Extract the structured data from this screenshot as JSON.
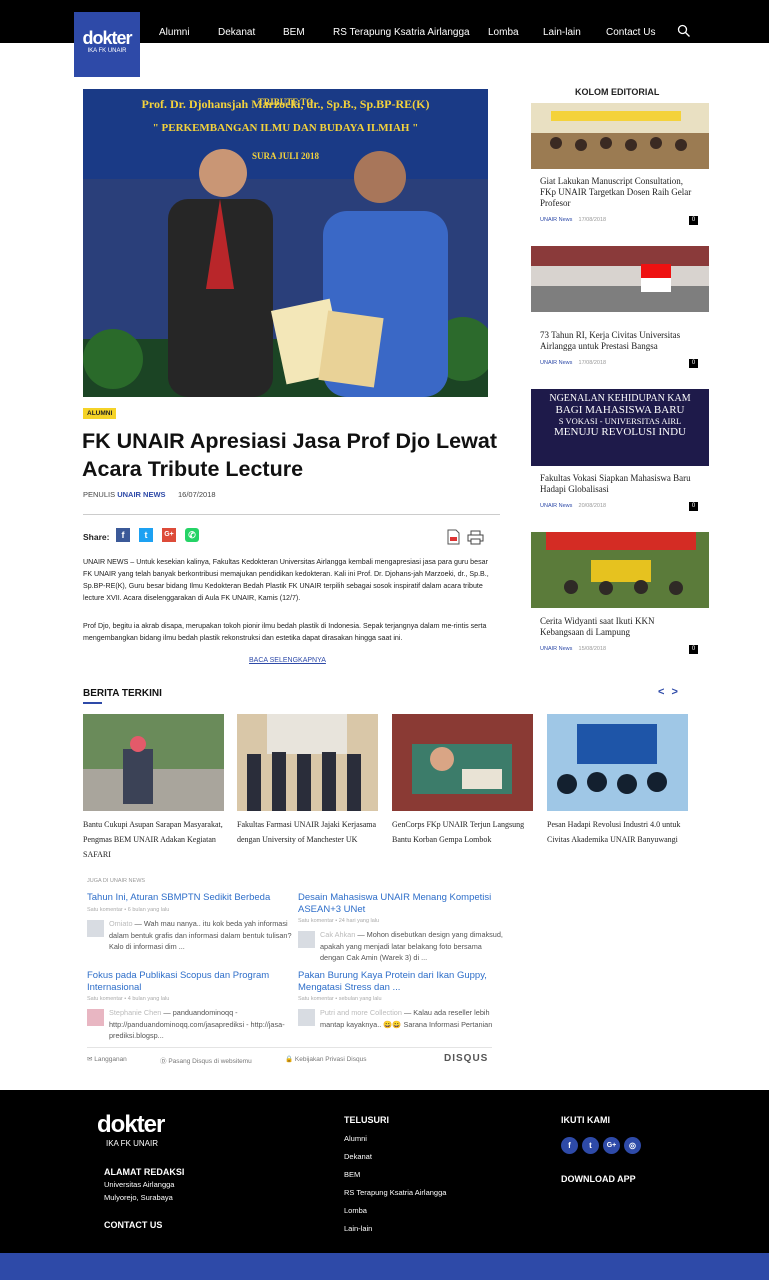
{
  "header": {
    "logo_word": "dokter",
    "logo_sub": "IKA FK UNAIR",
    "nav": [
      "Alumni",
      "Dekanat",
      "BEM",
      "RS Terapung Ksatria Airlangga",
      "Lomba",
      "Lain-lain",
      "Contact Us"
    ]
  },
  "article": {
    "hero_banner_line1": "TRIBUTE TO",
    "hero_banner_line2": "Prof. Dr. Djohansjah Marzoeki, dr., Sp.B., Sp.BP-RE(K)",
    "hero_banner_line3": "\" PERKEMBANGAN ILMU DAN BUDAYA ILMIAH \"",
    "hero_banner_line4": "SURA          JULI 2018",
    "category": "ALUMNI",
    "title": "FK UNAIR Apresiasi Jasa Prof Djo Lewat Acara Tribute Lecture",
    "author_label": "PENULIS",
    "author": "UNAIR NEWS",
    "date": "16/07/2018",
    "share_label": "Share:",
    "paragraph1": "UNAIR NEWS – Untuk kesekian kalinya, Fakultas Kedokteran Universitas Airlangga kembali mengapresiasi  jasa para guru besar FK UNAIR yang telah banyak berkontribusi memajukan pendidikan kedokteran. Kali ini Prof. Dr. Djohans-jah Marzoeki, dr., Sp.B., Sp.BP-RE(K), Guru besar bidang Ilmu Kedokteran Bedah Plastik FK UNAIR  terpilih sebagai sosok inspiratif dalam acara tribute lecture XVII. Acara diselenggarakan di Aula FK UNAIR, Kamis (12/7).",
    "paragraph2": "Prof Djo, begitu ia akrab disapa, merupakan tokoh pionir ilmu bedah plastik di Indonesia. Sepak terjangnya dalam me-rintis serta mengembangkan bidang ilmu bedah plastik rekonstruksi dan estetika dapat dirasakan hingga saat ini.",
    "read_more": "BACA SELENGKAPNYA"
  },
  "sidebar": {
    "heading": "KOLOM EDITORIAL",
    "items": [
      {
        "title": "Giat Lakukan Manuscript Consultation, FKp UNAIR Targetkan Dosen Raih Gelar Profesor",
        "source": "UNAIR News",
        "date": "17/08/2018",
        "count": "0"
      },
      {
        "title": "73 Tahun RI, Kerja Civitas Universitas Airlangga untuk Prestasi Bangsa",
        "source": "UNAIR News",
        "date": "17/08/2018",
        "count": "0"
      },
      {
        "title": "Fakultas Vokasi Siapkan Mahasiswa Baru Hadapi Globalisasi",
        "source": "UNAIR News",
        "date": "20/08/2018",
        "count": "0"
      },
      {
        "title": "Cerita Widyanti saat Ikuti KKN Kebangsaan di Lampung",
        "source": "UNAIR News",
        "date": "15/08/2018",
        "count": "0"
      }
    ],
    "banner_line1": "NGENALAN KEHIDUPAN KAM",
    "banner_line2": "BAGI MAHASISWA BARU",
    "banner_line3": "S VOKASI - UNIVERSITAS AIRL",
    "banner_line4": "MENUJU REVOLUSI INDU"
  },
  "berita_terkini": {
    "heading": "BERITA TERKINI",
    "arrows": "< >",
    "items": [
      "Bantu Cukupi Asupan Sarapan Masyarakat, Pengmas BEM UNAIR Adakan Kegiatan SAFARI",
      "Fakultas Farmasi UNAIR Jajaki Kerjasama dengan University of Manchester UK",
      "GenCorps FKp UNAIR Terjun Langsung Bantu Korban Gempa Lombok",
      "Pesan Hadapi Revolusi Industri 4.0 untuk Civitas Akademika UNAIR Banyuwangi"
    ]
  },
  "disqus": {
    "also_on": "JUGA DI UNAIR NEWS",
    "items": [
      {
        "title": "Tahun Ini, Aturan SBMPTN Sedikit Berbeda",
        "meta": "Satu komentar • 6 bulan yang lalu",
        "user": "Omiato",
        "comment": "Wah mau nanya.. itu kok beda yah informasi dalam bentuk grafis dan informasi dalam bentuk tulisan? Kalo di informasi dim ..."
      },
      {
        "title": "Desain Mahasiswa UNAIR Menang Kompetisi ASEAN+3 UNet",
        "meta": "Satu komentar • 24 hari yang lalu",
        "user": "Cak Ahkan",
        "comment": "Mohon disebutkan design yang dimaksud, apakah yang menjadi latar belakang foto bersama dengan Cak Amin (Warek 3) di ..."
      },
      {
        "title": "Fokus pada Publikasi Scopus dan Program Internasional",
        "meta": "Satu komentar • 4 bulan yang lalu",
        "user": "Stephanie Chen",
        "comment": "panduandominoqq - http://panduandominoqq.com/jasaprediksi - http://jasa-prediksi.blogsp..."
      },
      {
        "title": "Pakan Burung Kaya Protein dari Ikan Guppy, Mengatasi Stress dan ...",
        "meta": "Satu komentar • sebulan yang lalu",
        "user": "Putri and more Collection",
        "comment": "Kalau ada reseller lebih mantap kayaknya.. 😀😀 Sarana Informasi Pertanian"
      }
    ],
    "subscribe": "Langganan",
    "install": "Pasang Disqus di websitemu",
    "privacy": "Kebijakan Privasi Disqus",
    "brand": "DISQUS"
  },
  "footer": {
    "logo_word": "dokter",
    "logo_sub": "IKA FK UNAIR",
    "address_heading": "ALAMAT REDAKSI",
    "address_line1": "Universitas Airlangga",
    "address_line2": "Mulyorejo, Surabaya",
    "contact": "CONTACT US",
    "explore_heading": "TELUSURI",
    "links": [
      "Alumni",
      "Dekanat",
      "BEM",
      "RS Terapung Ksatria Airlangga",
      "Lomba",
      "Lain-lain"
    ],
    "follow_heading": "IKUTI KAMI",
    "download": "DOWNLOAD APP"
  },
  "colors": {
    "brand_blue": "#2e4aa8",
    "badge_yellow": "#f5d327",
    "disqus_link": "#2e6ec9"
  }
}
